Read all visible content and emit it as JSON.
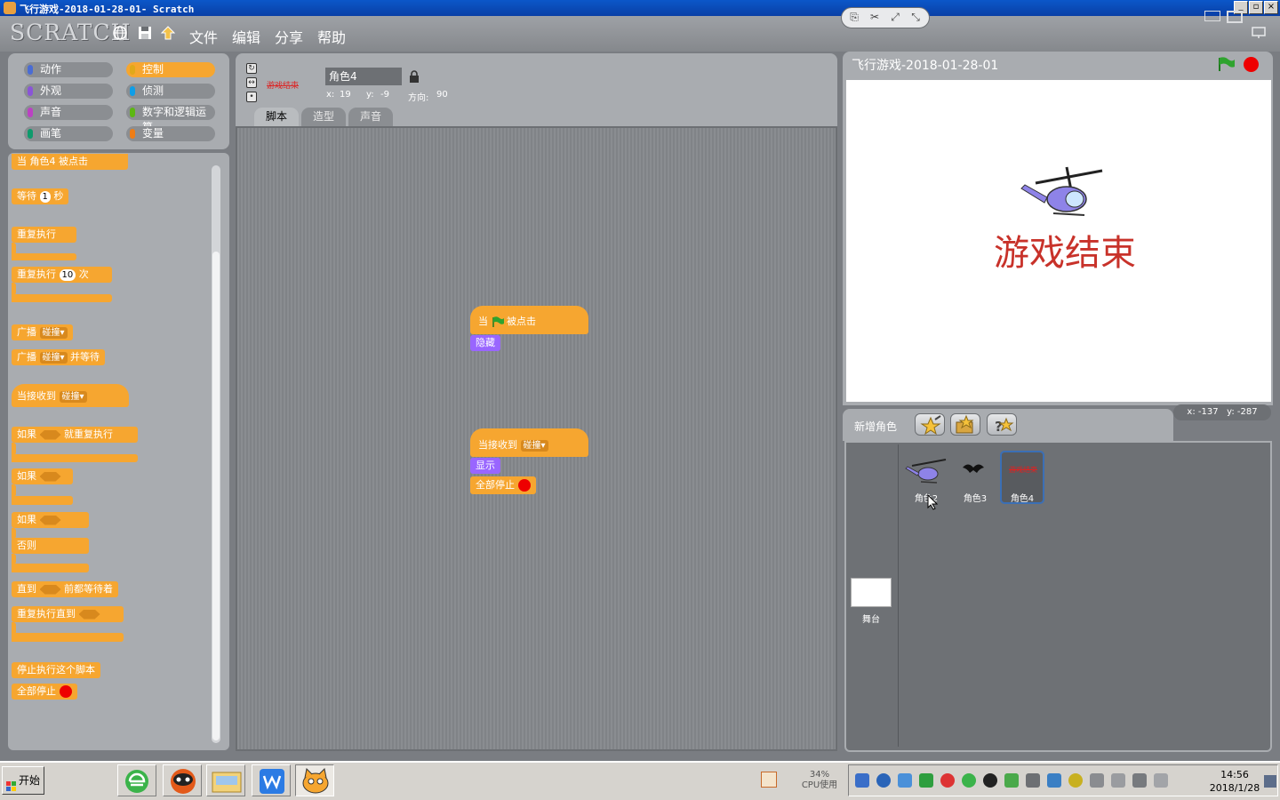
{
  "window": {
    "title": "飞行游戏-2018-01-28-01- Scratch",
    "min": "_",
    "max": "▫",
    "close": "×"
  },
  "menubar": {
    "logo": "SCRATCH",
    "file": "文件",
    "edit": "编辑",
    "share": "分享",
    "help": "帮助"
  },
  "categories": {
    "motion": "动作",
    "control": "控制",
    "looks": "外观",
    "sensing": "侦测",
    "sound": "声音",
    "operators": "数字和逻辑运算",
    "pen": "画笔",
    "variables": "变量",
    "colors": {
      "motion": "#4a6cd4",
      "control": "#e1a91a",
      "looks": "#8a55d7",
      "sensing": "#0e9ee8",
      "sound": "#bb42c3",
      "operators": "#5cb712",
      "pen": "#0e9a6c",
      "variables": "#ee7d16"
    }
  },
  "palette": {
    "when_sprite_clicked": "当 角色4 被点击",
    "wait": "等待",
    "wait_val": "1",
    "wait_unit": "秒",
    "forever": "重复执行",
    "repeat": "重复执行",
    "repeat_val": "10",
    "repeat_unit": "次",
    "broadcast": "广播",
    "broadcast_msg": "碰撞",
    "broadcast_wait": "广播",
    "broadcast_wait_msg": "碰撞",
    "broadcast_wait_suffix": "并等待",
    "when_receive": "当接收到",
    "when_receive_msg": "碰撞",
    "forever_if": "如果",
    "forever_if_suffix": "就重复执行",
    "if": "如果",
    "if_else": "如果",
    "else": "否则",
    "wait_until": "直到",
    "wait_until_suffix": "前都等待着",
    "repeat_until": "重复执行直到",
    "stop_script": "停止执行这个脚本",
    "stop_all": "全部停止"
  },
  "sprite_info": {
    "name": "角色4",
    "x_label": "x:",
    "x": "19",
    "y_label": "y:",
    "y": "-9",
    "dir_label": "方向:",
    "dir": "90",
    "thumb_text": "游戏结束"
  },
  "tabs": {
    "scripts": "脚本",
    "costumes": "造型",
    "sounds": "声音"
  },
  "script1": {
    "when": "当",
    "clicked": "被点击",
    "hide": "隐藏"
  },
  "script2": {
    "when_receive": "当接收到",
    "msg": "碰撞",
    "show": "显示",
    "stop_all": "全部停止"
  },
  "stage": {
    "title": "飞行游戏-2018-01-28-01",
    "text": "游戏结束",
    "mouse_x": "x: -137",
    "mouse_y": "y: -287"
  },
  "library": {
    "new_sprite": "新增角色",
    "sprites": [
      {
        "name": "角色2"
      },
      {
        "name": "角色3"
      },
      {
        "name": "角色4"
      }
    ],
    "selected_thumb_text": "游戏结束",
    "stage_label": "舞台"
  },
  "taskbar": {
    "start": "开始",
    "cpu_pct": "34%",
    "cpu_label": "CPU使用",
    "time": "14:56",
    "date": "2018/1/28"
  }
}
